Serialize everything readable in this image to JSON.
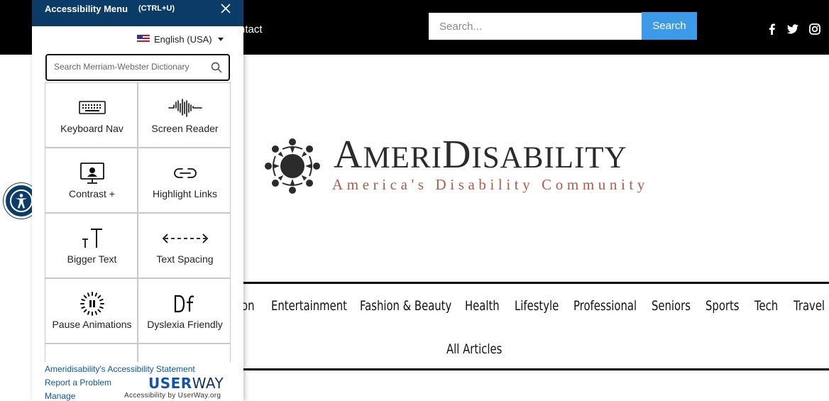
{
  "site": {
    "nav_contact": "ntact",
    "search": {
      "placeholder": "Search...",
      "button_label": "Search"
    },
    "social": [
      "facebook-icon",
      "twitter-icon",
      "instagram-icon"
    ],
    "logo": {
      "title_first": "A",
      "title_rest_1": "MERI",
      "title_d": "D",
      "title_rest_2": "ISABILITY",
      "tagline": "America's Disability Community"
    },
    "categories": [
      "on",
      "Entertainment",
      "Fashion & Beauty",
      "Health",
      "Lifestyle",
      "Professional",
      "Seniors",
      "Sports",
      "Tech",
      "Travel"
    ],
    "all_articles": "All Articles"
  },
  "panel": {
    "title": "Accessibility Menu",
    "shortcut": "(CTRL+U)",
    "language": "English (USA)",
    "dictionary_placeholder": "Search Merriam-Webster Dictionary",
    "tools": [
      {
        "label": "Keyboard Nav",
        "icon": "keyboard-icon"
      },
      {
        "label": "Screen Reader",
        "icon": "sound-wave-icon"
      },
      {
        "label": "Contrast +",
        "icon": "monitor-icon"
      },
      {
        "label": "Highlight Links",
        "icon": "link-icon"
      },
      {
        "label": "Bigger Text",
        "icon": "text-size-icon"
      },
      {
        "label": "Text Spacing",
        "icon": "text-spacing-icon"
      },
      {
        "label": "Pause Animations",
        "icon": "pause-icon"
      },
      {
        "label": "Dyslexia Friendly",
        "icon": "dyslexia-icon"
      }
    ],
    "footer": {
      "statement_link": "Ameridisability's Accessibility Statement",
      "report_link": "Report a Problem",
      "manage_link": "Manage",
      "brand_user": "USER",
      "brand_way": "WAY",
      "brand_by": "Accessibility by UserWay.org"
    }
  },
  "colors": {
    "panel_header": "#0b3c68",
    "search_button": "#3d9ae8",
    "tagline": "#b05a47",
    "link": "#0f56a8"
  }
}
